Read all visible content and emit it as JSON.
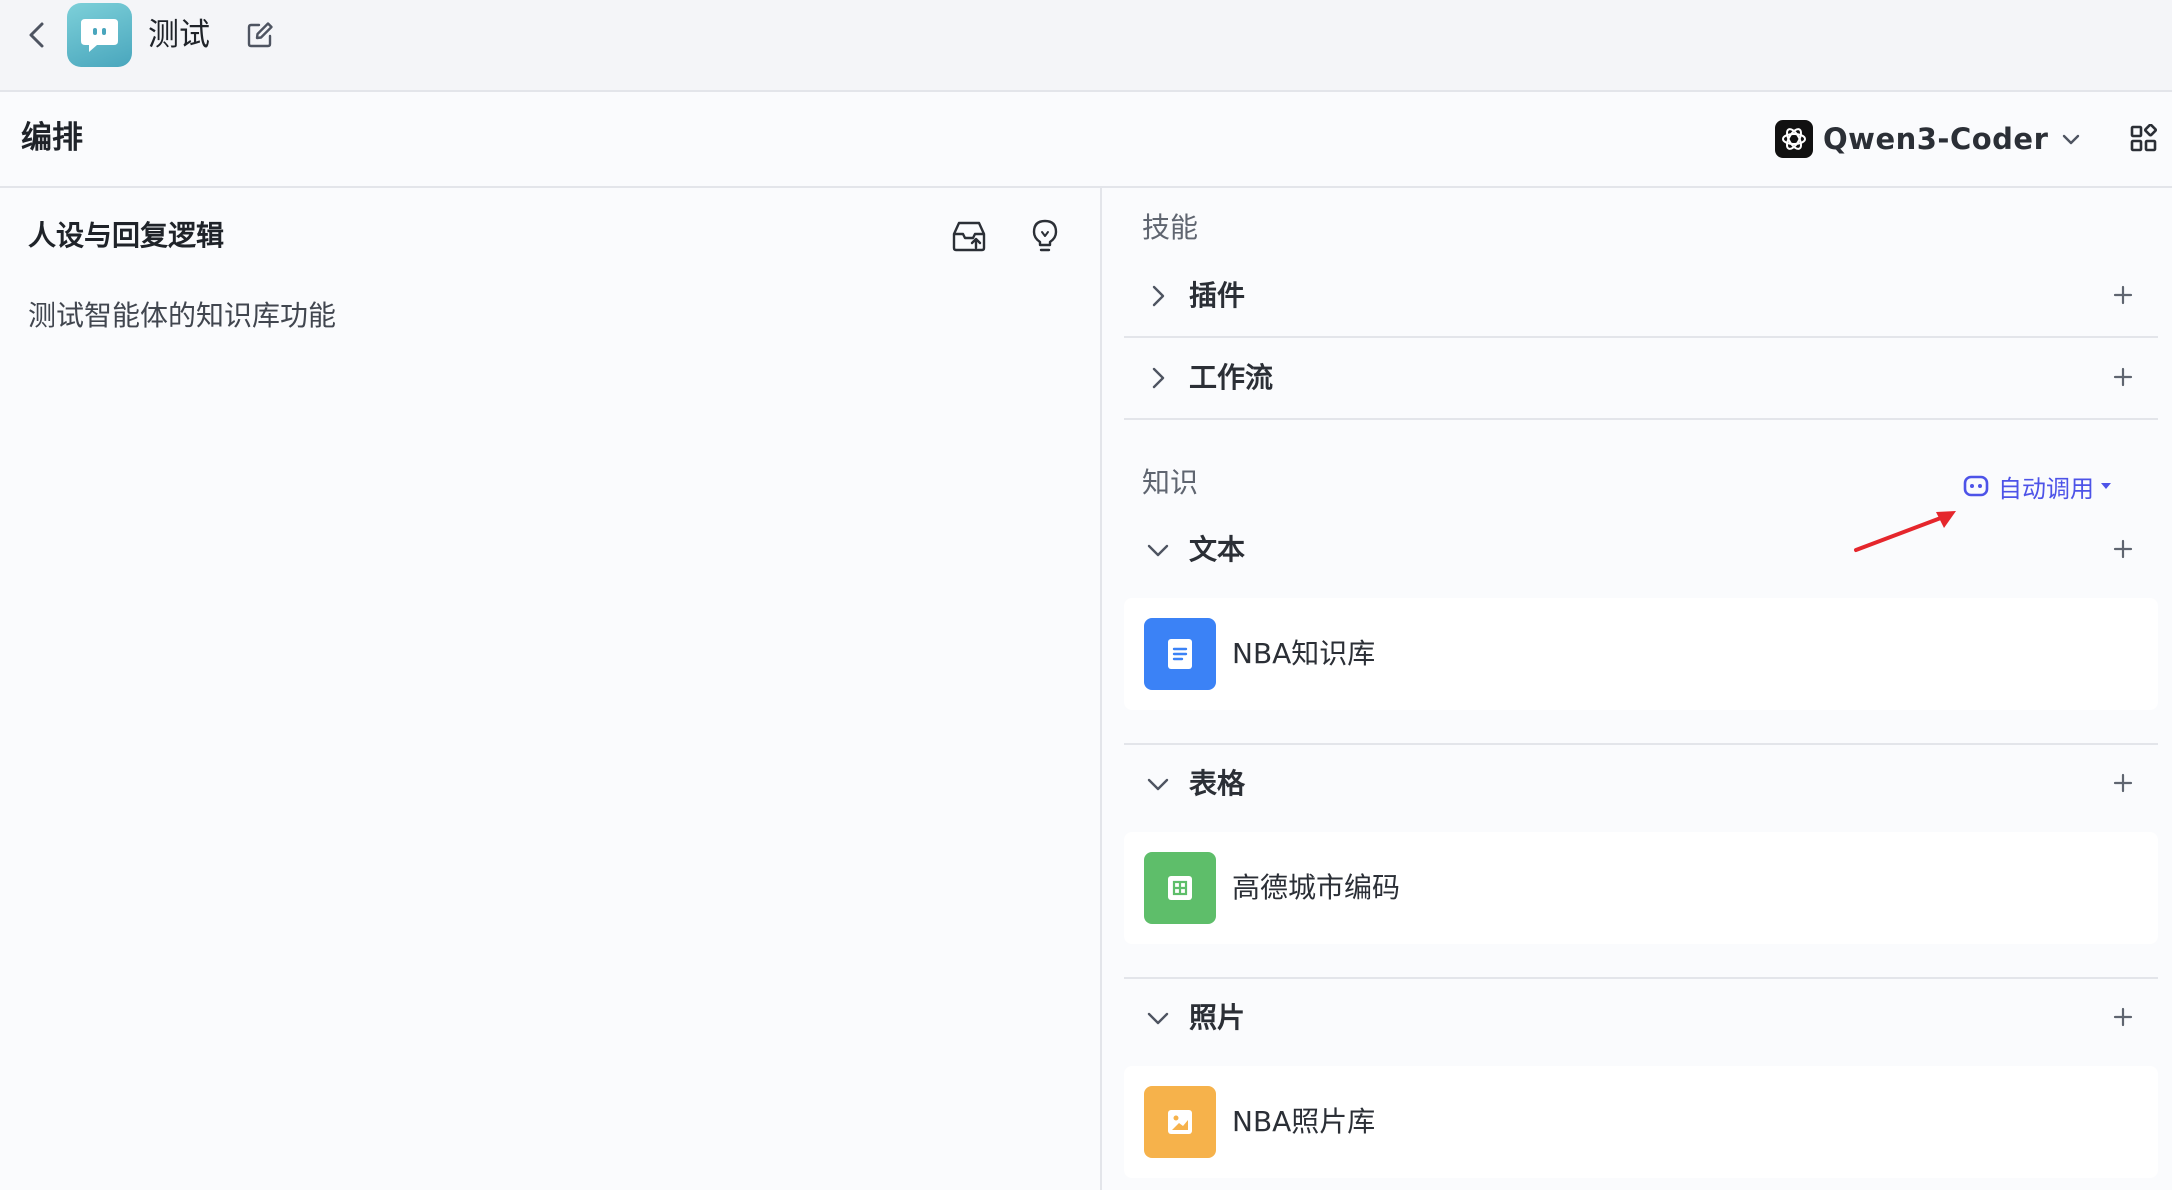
{
  "app": {
    "title": "测试",
    "section_title": "编排"
  },
  "model": {
    "name": "Qwen3-Coder"
  },
  "persona": {
    "title": "人设与回复逻辑",
    "prompt": "测试智能体的知识库功能"
  },
  "skills": {
    "label": "技能",
    "items": [
      {
        "label": "插件"
      },
      {
        "label": "工作流"
      }
    ]
  },
  "knowledge": {
    "label": "知识",
    "auto_call_label": "自动调用",
    "groups": [
      {
        "label": "文本",
        "item": "NBA知识库",
        "icon": "document-icon",
        "color": "#3b82f6"
      },
      {
        "label": "表格",
        "item": "高德城市编码",
        "icon": "table-icon",
        "color": "#5ebe6a"
      },
      {
        "label": "照片",
        "item": "NBA照片库",
        "icon": "image-icon",
        "color": "#f6b24b"
      }
    ]
  },
  "colors": {
    "accent": "#4d53e8",
    "annotation_arrow": "#e5262c"
  }
}
